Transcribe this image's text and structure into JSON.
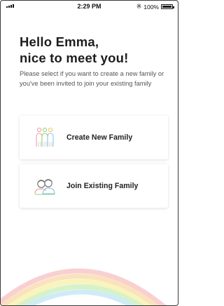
{
  "status": {
    "time": "2:29 PM",
    "battery": "100%",
    "signal": "signal-icon",
    "bluetooth": "bluetooth-icon"
  },
  "greeting": {
    "line1": "Hello Emma,",
    "line2": "nice to meet you!"
  },
  "description": "Please select if you want to create a new family or you've been invited to join your existing family",
  "options": [
    {
      "label": "Create New Family",
      "icon": "family-icon"
    },
    {
      "label": "Join Existing Family",
      "icon": "couple-icon"
    }
  ],
  "colors": {
    "title": "#1d1d1d",
    "text": "#555555",
    "rainbow": [
      "#f7c0c0",
      "#f9d9a8",
      "#f7efa6",
      "#c8eeb9",
      "#bfe5f5"
    ]
  }
}
